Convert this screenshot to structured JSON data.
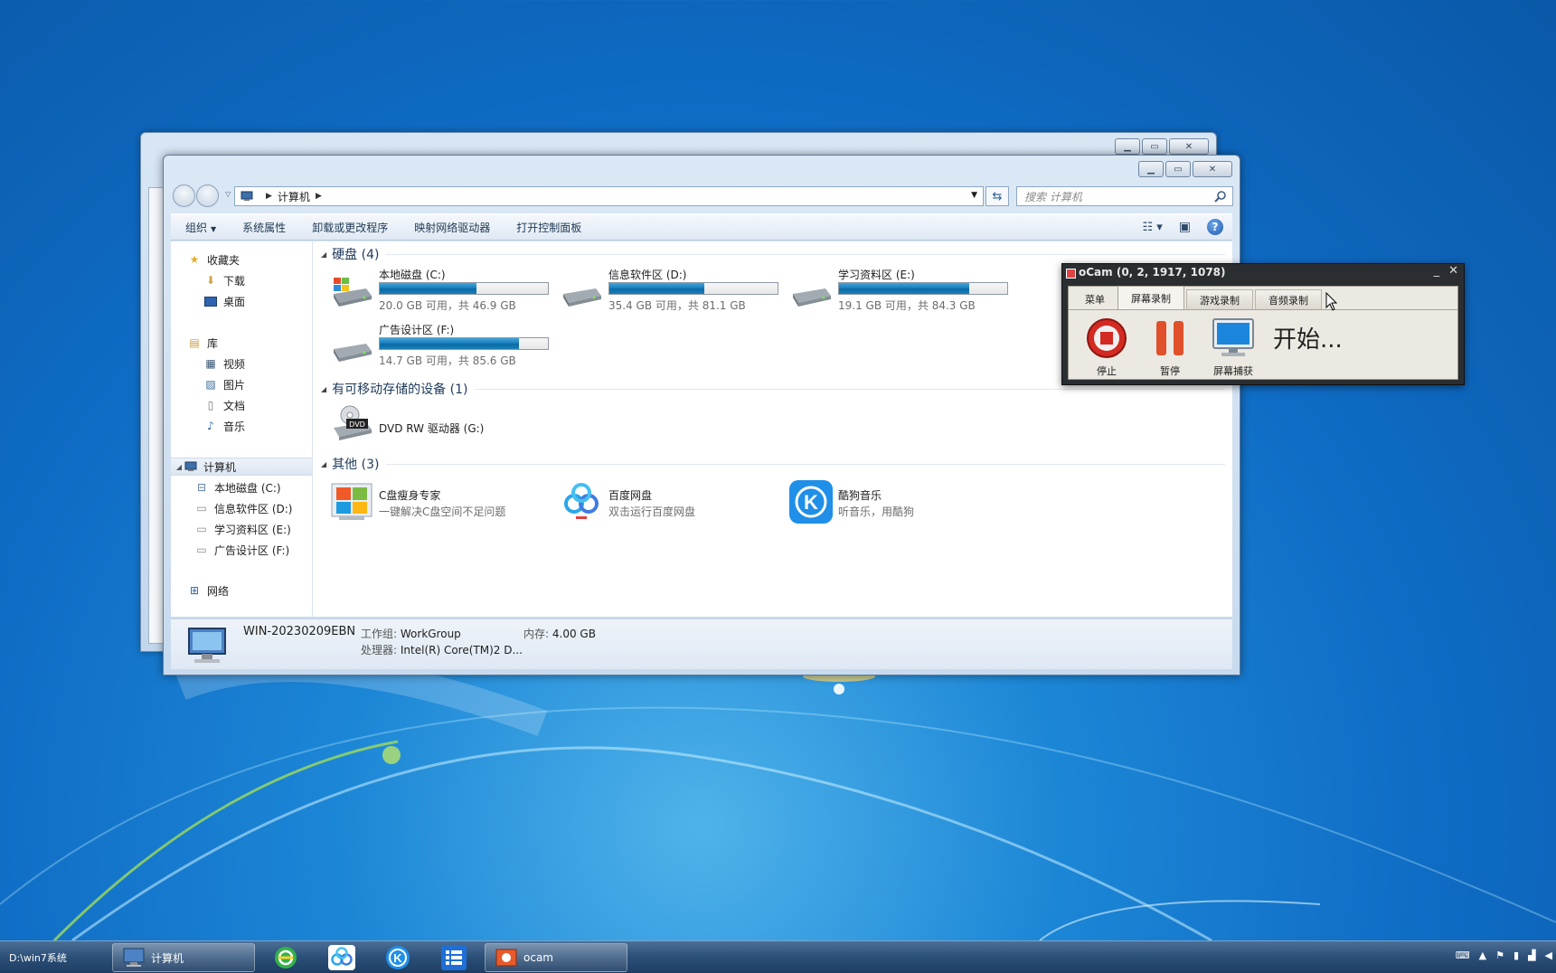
{
  "wallpaper": {
    "color": "#1278cc"
  },
  "explorer": {
    "address": {
      "crumb": "计算机"
    },
    "search": {
      "placeholder": "搜索 计算机"
    },
    "cmdbar": {
      "organize": "组织",
      "items": [
        "系统属性",
        "卸载或更改程序",
        "映射网络驱动器",
        "打开控制面板"
      ]
    },
    "nav": {
      "favorites": "收藏夹",
      "downloads": "下载",
      "desktop": "桌面",
      "libraries": "库",
      "videos": "视频",
      "pictures": "图片",
      "documents": "文档",
      "music": "音乐",
      "computer": "计算机",
      "drive_c": "本地磁盘 (C:)",
      "drive_d": "信息软件区 (D:)",
      "drive_e": "学习资料区 (E:)",
      "drive_f": "广告设计区 (F:)",
      "network": "网络"
    },
    "groups": {
      "hdd": "硬盘 (4)",
      "removable": "有可移动存储的设备 (1)",
      "other": "其他 (3)"
    },
    "drives": [
      {
        "name": "本地磁盘 (C:)",
        "free": "20.0 GB 可用，共 46.9 GB",
        "used_fraction": 0.574
      },
      {
        "name": "信息软件区 (D:)",
        "free": "35.4 GB 可用，共 81.1 GB",
        "used_fraction": 0.563
      },
      {
        "name": "学习资料区 (E:)",
        "free": "19.1 GB 可用，共 84.3 GB",
        "used_fraction": 0.773
      },
      {
        "name": "广告设计区 (F:)",
        "free": "14.7 GB 可用，共 85.6 GB",
        "used_fraction": 0.828
      }
    ],
    "dvd": {
      "name": "DVD RW 驱动器 (G:)",
      "icon_label": "DVD"
    },
    "others": [
      {
        "name": "C盘瘦身专家",
        "desc": "一键解决C盘空间不足问题",
        "icon": "windows-flag-icon"
      },
      {
        "name": "百度网盘",
        "desc": "双击运行百度网盘",
        "icon": "baidu-netdisk-icon"
      },
      {
        "name": "酷狗音乐",
        "desc": "听音乐，用酷狗",
        "icon": "kugou-icon",
        "icon_letter": "K"
      }
    ],
    "details": {
      "pc_name": "WIN-20230209EBN",
      "workgroup_label": "工作组:",
      "workgroup": "WorkGroup",
      "memory_label": "内存:",
      "memory": "4.00 GB",
      "cpu_label": "处理器:",
      "cpu": "Intel(R) Core(TM)2 D..."
    }
  },
  "ocam": {
    "title": "oCam (0, 2, 1917, 1078)",
    "tabs": [
      "菜单",
      "屏幕录制",
      "游戏录制",
      "音频录制"
    ],
    "selected_tab": "屏幕录制",
    "buttons": {
      "stop": "停止",
      "pause": "暂停",
      "capture": "屏幕捕获"
    },
    "status": "开始..."
  },
  "taskbar": {
    "path": "D:\\win7系统",
    "tasks": [
      {
        "label": "计算机"
      },
      {
        "label": "ocam"
      }
    ],
    "pinned": [
      "360-browser-icon",
      "baidu-netdisk-icon",
      "kugou-icon",
      "list-app-icon"
    ]
  }
}
